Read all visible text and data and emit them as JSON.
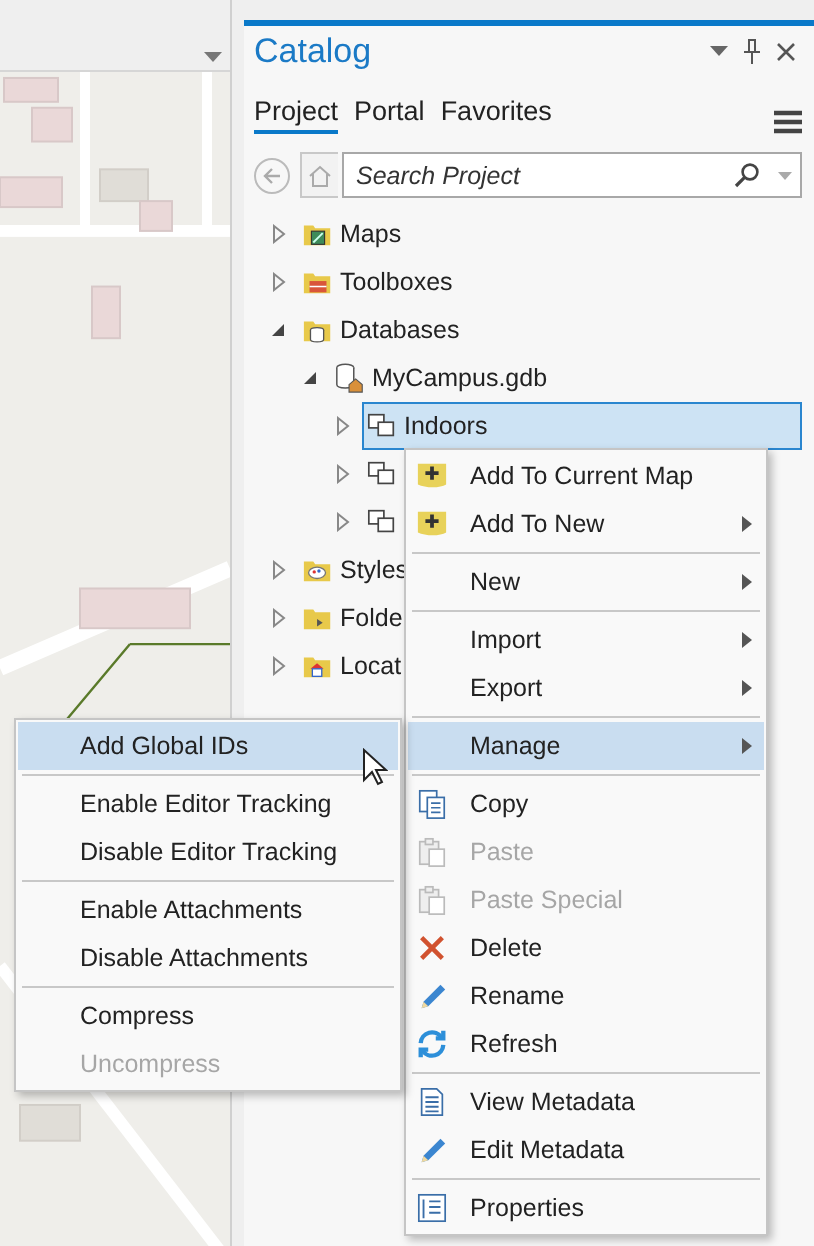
{
  "catalog": {
    "title": "Catalog",
    "tabs": [
      {
        "label": "Project",
        "selected": true
      },
      {
        "label": "Portal",
        "selected": false
      },
      {
        "label": "Favorites",
        "selected": false
      }
    ],
    "search": {
      "placeholder": "Search Project"
    },
    "tree": [
      {
        "label": "Maps",
        "expanded": false,
        "selected": false
      },
      {
        "label": "Toolboxes",
        "expanded": false,
        "selected": false
      },
      {
        "label": "Databases",
        "expanded": true,
        "selected": false,
        "children": [
          {
            "label": "MyCampus.gdb",
            "expanded": true,
            "selected": false,
            "children": [
              {
                "label": "Indoors",
                "expanded": false,
                "selected": true
              },
              {
                "expanded": false,
                "selected": false
              },
              {
                "expanded": false,
                "selected": false
              }
            ]
          }
        ]
      },
      {
        "label": "Styles",
        "expanded": false,
        "selected": false
      },
      {
        "label": "Folde",
        "expanded": false,
        "selected": false
      },
      {
        "label": "Locat",
        "expanded": false,
        "selected": false
      }
    ]
  },
  "context_menu": {
    "items": [
      {
        "kind": "item",
        "label": "Add To Current Map",
        "submenu": false,
        "selected": false,
        "disabled": false
      },
      {
        "kind": "item",
        "label": "Add To New",
        "submenu": true,
        "selected": false,
        "disabled": false
      },
      {
        "kind": "separator"
      },
      {
        "kind": "item",
        "label": "New",
        "submenu": true,
        "selected": false,
        "disabled": false
      },
      {
        "kind": "separator"
      },
      {
        "kind": "item",
        "label": "Import",
        "submenu": true,
        "selected": false,
        "disabled": false
      },
      {
        "kind": "item",
        "label": "Export",
        "submenu": true,
        "selected": false,
        "disabled": false
      },
      {
        "kind": "separator"
      },
      {
        "kind": "item",
        "label": "Manage",
        "submenu": true,
        "selected": true,
        "disabled": false
      },
      {
        "kind": "separator"
      },
      {
        "kind": "item",
        "label": "Copy",
        "submenu": false,
        "selected": false,
        "disabled": false
      },
      {
        "kind": "item",
        "label": "Paste",
        "submenu": false,
        "selected": false,
        "disabled": true
      },
      {
        "kind": "item",
        "label": "Paste Special",
        "submenu": false,
        "selected": false,
        "disabled": true
      },
      {
        "kind": "item",
        "label": "Delete",
        "submenu": false,
        "selected": false,
        "disabled": false
      },
      {
        "kind": "item",
        "label": "Rename",
        "submenu": false,
        "selected": false,
        "disabled": false
      },
      {
        "kind": "item",
        "label": "Refresh",
        "submenu": false,
        "selected": false,
        "disabled": false
      },
      {
        "kind": "separator"
      },
      {
        "kind": "item",
        "label": "View Metadata",
        "submenu": false,
        "selected": false,
        "disabled": false
      },
      {
        "kind": "item",
        "label": "Edit Metadata",
        "submenu": false,
        "selected": false,
        "disabled": false
      },
      {
        "kind": "separator"
      },
      {
        "kind": "item",
        "label": "Properties",
        "submenu": false,
        "selected": false,
        "disabled": false
      }
    ]
  },
  "submenu": {
    "items": [
      {
        "kind": "item",
        "label": "Add Global IDs",
        "selected": true,
        "disabled": false
      },
      {
        "kind": "separator"
      },
      {
        "kind": "item",
        "label": "Enable Editor Tracking",
        "selected": false,
        "disabled": false
      },
      {
        "kind": "item",
        "label": "Disable Editor Tracking",
        "selected": false,
        "disabled": false
      },
      {
        "kind": "separator"
      },
      {
        "kind": "item",
        "label": "Enable Attachments",
        "selected": false,
        "disabled": false
      },
      {
        "kind": "item",
        "label": "Disable Attachments",
        "selected": false,
        "disabled": false
      },
      {
        "kind": "separator"
      },
      {
        "kind": "item",
        "label": "Compress",
        "selected": false,
        "disabled": false
      },
      {
        "kind": "item",
        "label": "Uncompress",
        "selected": false,
        "disabled": true
      }
    ]
  }
}
